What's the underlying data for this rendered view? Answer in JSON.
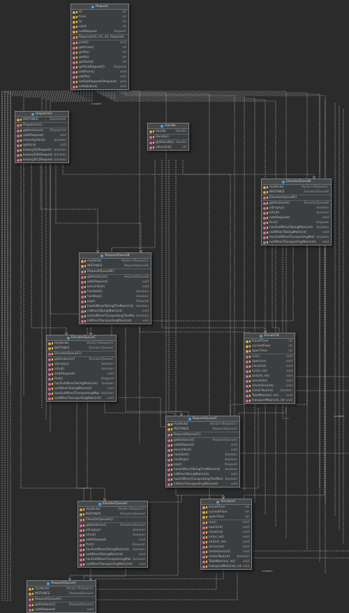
{
  "classes": [
    {
      "id": "request",
      "title": "Request",
      "fields": [
        {
          "name": "id",
          "type": "int"
        },
        {
          "name": "from",
          "type": "int"
        },
        {
          "name": "to",
          "type": "int"
        },
        {
          "name": "valid",
          "type": "int"
        },
        {
          "name": "subRequest",
          "type": "Request"
        }
      ],
      "constructors": [
        {
          "name": "Request(int, int, int, Request)",
          "type": ""
        }
      ],
      "methods": [
        {
          "name": "print()",
          "type": "void"
        },
        {
          "name": "getFrom()",
          "type": "int"
        },
        {
          "name": "getTo()",
          "type": "int"
        },
        {
          "name": "getId()",
          "type": "int"
        },
        {
          "name": "getValid()",
          "type": "int"
        },
        {
          "name": "getSubRequest()",
          "type": "Request"
        },
        {
          "name": "addFrom()",
          "type": "void"
        },
        {
          "name": "addTo()",
          "type": "void"
        },
        {
          "name": "setSubRequest(Request)",
          "type": "void"
        },
        {
          "name": "setValid(int)",
          "type": "void"
        }
      ]
    },
    {
      "id": "dispatcher",
      "title": "Dispatcher",
      "fields": [
        {
          "name": "INSTANCE",
          "type": "Dispatcher"
        }
      ],
      "constructors": [
        {
          "name": "Dispatcher()",
          "type": ""
        }
      ],
      "methods": [
        {
          "name": "getInstance()",
          "type": "Dispatcher"
        },
        {
          "name": "add(Request)",
          "type": "void"
        },
        {
          "name": "checkSplit(int)",
          "type": "boolean"
        },
        {
          "name": "split(int)",
          "type": "int[]"
        },
        {
          "name": "belongTo(Request)",
          "type": "boolean"
        },
        {
          "name": "belongToB(Request)",
          "type": "boolean"
        },
        {
          "name": "belongToC(Request)",
          "type": "boolean"
        }
      ]
    },
    {
      "id": "handle",
      "title": "Handle",
      "fields": [
        {
          "name": "handle",
          "type": "Handle"
        }
      ],
      "constructors": [
        {
          "name": "Handle()",
          "type": ""
        }
      ],
      "methods": [
        {
          "name": "getHandle()",
          "type": "Handle"
        },
        {
          "name": "return(int)",
          "type": "int"
        }
      ]
    },
    {
      "id": "elevator-queue-b",
      "title": "ElevatorQueueB",
      "fields": [
        {
          "name": "myVector",
          "type": "Vector<Request>"
        },
        {
          "name": "INSTANCE",
          "type": "ElevatorQueueB"
        }
      ],
      "constructors": [
        {
          "name": "ElevatorQueueB()",
          "type": ""
        }
      ],
      "methods": [
        {
          "name": "getInstance()",
          "type": "ElevatorQueueB"
        },
        {
          "name": "isEmpty()",
          "type": "boolean"
        },
        {
          "name": "isFull()",
          "type": "boolean"
        },
        {
          "name": "add(Request)",
          "type": "void"
        },
        {
          "name": "first()",
          "type": "Request"
        },
        {
          "name": "hasOutWhenTakingMain(int)",
          "type": "boolean"
        },
        {
          "name": "outWhenTakingMain(int)",
          "type": "void"
        },
        {
          "name": "hasOutWhenTransportingMain(int)",
          "type": "boolean"
        },
        {
          "name": "outWhenTransportingMain(int)",
          "type": "void"
        }
      ]
    },
    {
      "id": "request-queue-b",
      "title": "RequestQueueB",
      "fields": [
        {
          "name": "myVector",
          "type": "Vector<Request>"
        },
        {
          "name": "INSTANCE",
          "type": "RequestQueueB"
        }
      ],
      "constructors": [
        {
          "name": "RequestQueueB()",
          "type": ""
        }
      ],
      "methods": [
        {
          "name": "getInstance()",
          "type": "RequestQueueB"
        },
        {
          "name": "add(Request)",
          "type": "void"
        },
        {
          "name": "benchRed()",
          "type": "void"
        },
        {
          "name": "hasValid()",
          "type": "boolean"
        },
        {
          "name": "hasStop()",
          "type": "boolean"
        },
        {
          "name": "pop()",
          "type": "Request"
        },
        {
          "name": "hasInWhenTakingTheMain(int)",
          "type": "boolean"
        },
        {
          "name": "inWhenTakingMain(int)",
          "type": "void"
        },
        {
          "name": "hasInWhenTransportingTheMain(int)",
          "type": "boolean"
        },
        {
          "name": "inWhenTransportingMain(int)",
          "type": "void"
        }
      ]
    },
    {
      "id": "elevator-queue-c",
      "title": "ElevatorQueueC",
      "fields": [
        {
          "name": "myVector",
          "type": "Vector<Request>"
        },
        {
          "name": "INSTANCE",
          "type": "ElevatorQueueC"
        }
      ],
      "constructors": [
        {
          "name": "ElevatorQueueC()",
          "type": ""
        }
      ],
      "methods": [
        {
          "name": "getInstance()",
          "type": "ElevatorQueueC"
        },
        {
          "name": "isEmpty()",
          "type": "boolean"
        },
        {
          "name": "isFull()",
          "type": "boolean"
        },
        {
          "name": "add(Request)",
          "type": "void"
        },
        {
          "name": "first()",
          "type": "Request"
        },
        {
          "name": "hasOutWhenTakingMain(int)",
          "type": "boolean"
        },
        {
          "name": "outWhenTakingMain(int)",
          "type": "void"
        },
        {
          "name": "hasOutWhenTransportingMain(int)",
          "type": "boolean"
        },
        {
          "name": "outWhenTransportingMain(int)",
          "type": "void"
        }
      ]
    },
    {
      "id": "elevator-b",
      "title": "ElevatorB",
      "fields": [
        {
          "name": "travelTime",
          "type": "int"
        },
        {
          "name": "currentFloor",
          "type": "int"
        },
        {
          "name": "openTime",
          "type": "int"
        }
      ],
      "constructors": [],
      "methods": [
        {
          "name": "run()",
          "type": "void"
        },
        {
          "name": "open(int)",
          "type": "void"
        },
        {
          "name": "close(int)",
          "type": "void"
        },
        {
          "name": "in(int, int)",
          "type": "void"
        },
        {
          "name": "out(int, int)",
          "type": "void"
        },
        {
          "name": "arrive(int)",
          "type": "void"
        },
        {
          "name": "checkOne(int)",
          "type": "void"
        },
        {
          "name": "checkTwo(int)",
          "type": "boolean"
        },
        {
          "name": "TakeMain(int, int)",
          "type": "void"
        },
        {
          "name": "transportMain(int, int)",
          "type": "void"
        }
      ]
    },
    {
      "id": "request-queue-c",
      "title": "RequestQueueC",
      "fields": [
        {
          "name": "myVector",
          "type": "Vector<Request>"
        },
        {
          "name": "INSTANCE",
          "type": "RequestQueueC"
        }
      ],
      "constructors": [
        {
          "name": "RequestQueueC()",
          "type": ""
        }
      ],
      "methods": [
        {
          "name": "getInstance()",
          "type": "RequestQueueC"
        },
        {
          "name": "add(Request)",
          "type": "void"
        },
        {
          "name": "benchRed()",
          "type": "void"
        },
        {
          "name": "hasValid()",
          "type": "boolean"
        },
        {
          "name": "hasStop()",
          "type": "boolean"
        },
        {
          "name": "pop()",
          "type": "Request"
        },
        {
          "name": "hasInWhenTakingTheMain(int)",
          "type": "boolean"
        },
        {
          "name": "inWhenTakingMain(int)",
          "type": "void"
        },
        {
          "name": "hasInWhenTransportingTheMain(int)",
          "type": "boolean"
        },
        {
          "name": "inWhenTransportingMain(int)",
          "type": "void"
        }
      ]
    },
    {
      "id": "elevator-queue-a",
      "title": "ElevatorQueueA",
      "fields": [
        {
          "name": "myVector",
          "type": "Vector<Request>"
        },
        {
          "name": "INSTANCE",
          "type": "ElevatorQueueA"
        }
      ],
      "constructors": [
        {
          "name": "ElevatorQueueA()",
          "type": ""
        }
      ],
      "methods": [
        {
          "name": "getInstance()",
          "type": "ElevatorQueueA"
        },
        {
          "name": "isEmpty()",
          "type": "boolean"
        },
        {
          "name": "isFull()",
          "type": "boolean"
        },
        {
          "name": "add(Request)",
          "type": "void"
        },
        {
          "name": "first()",
          "type": "Request"
        },
        {
          "name": "hasOutWhenTakingMain(int)",
          "type": "boolean"
        },
        {
          "name": "outWhenTakingMain(int)",
          "type": "void"
        },
        {
          "name": "hasOutWhenTransportingMain(int)",
          "type": "boolean"
        },
        {
          "name": "outWhenTransportingMain(int)",
          "type": "void"
        }
      ]
    },
    {
      "id": "elevator-c",
      "title": "ElevatorC",
      "fields": [
        {
          "name": "travelTime",
          "type": "int"
        },
        {
          "name": "currentFloor",
          "type": "int"
        },
        {
          "name": "openTime",
          "type": "int"
        }
      ],
      "constructors": [],
      "methods": [
        {
          "name": "run()",
          "type": "void"
        },
        {
          "name": "open(int)",
          "type": "void"
        },
        {
          "name": "close(int)",
          "type": "void"
        },
        {
          "name": "in(int, int)",
          "type": "void"
        },
        {
          "name": "out(int, int)",
          "type": "void"
        },
        {
          "name": "arrive(int)",
          "type": "void"
        },
        {
          "name": "checkOne(int)",
          "type": "void"
        },
        {
          "name": "checkTwo(int)",
          "type": "boolean"
        },
        {
          "name": "TakeMain(int, int)",
          "type": "void"
        },
        {
          "name": "transportMain(int, int)",
          "type": "void"
        }
      ]
    },
    {
      "id": "request-queue-a",
      "title": "RequestQueueA",
      "fields": [
        {
          "name": "myVector",
          "type": "Vector<Request>"
        },
        {
          "name": "INSTANCE",
          "type": "RequestQueueA"
        }
      ],
      "constructors": [
        {
          "name": "RequestQueueA()",
          "type": ""
        }
      ],
      "methods": [
        {
          "name": "getInstance()",
          "type": "RequestQueueA"
        },
        {
          "name": "add(Request)",
          "type": "void"
        }
      ]
    }
  ],
  "edge_labels": [
    "«create»",
    "«create»",
    "«create»"
  ],
  "colors": {
    "background": "#2b2b2b",
    "box": "#3c3f41",
    "class_icon": "#4b9ee0",
    "field_icon": "#e0a43a",
    "method_icon": "#d86a8c",
    "wire": "#c8c8c8"
  }
}
